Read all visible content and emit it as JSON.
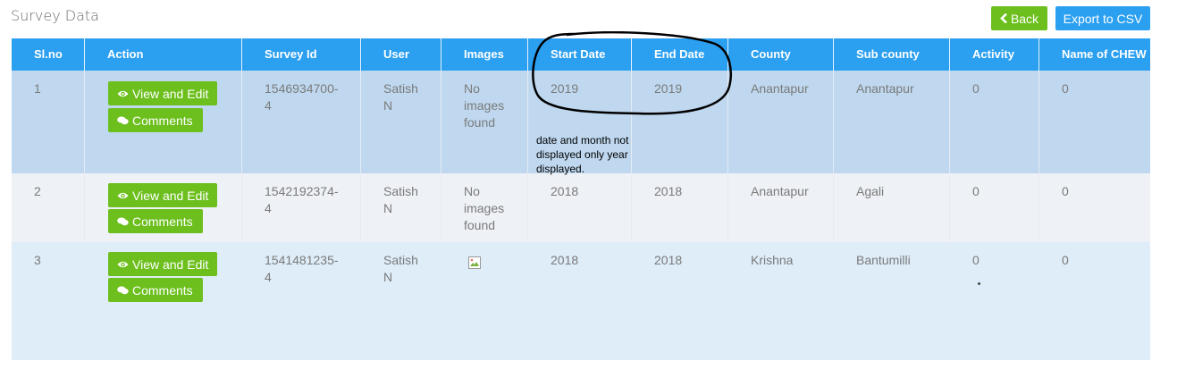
{
  "page": {
    "title": "Survey Data"
  },
  "toolbar": {
    "back_label": "Back",
    "export_label": "Export to CSV"
  },
  "table": {
    "columns": [
      "Sl.no",
      "Action",
      "Survey Id",
      "User",
      "Images",
      "Start Date",
      "End Date",
      "County",
      "Sub county",
      "Activity",
      "Name of CHEW"
    ],
    "action_labels": {
      "view_edit": "View and Edit",
      "comments": "Comments"
    },
    "rows": [
      {
        "slno": "1",
        "survey_id": "1546934700-4",
        "user": "Satish N",
        "images": "No images found",
        "start_date": "2019",
        "end_date": "2019",
        "county": "Anantapur",
        "sub_county": "Anantapur",
        "activity": "0",
        "chew": "0"
      },
      {
        "slno": "2",
        "survey_id": "1542192374-4",
        "user": "Satish N",
        "images": "No images found",
        "start_date": "2018",
        "end_date": "2018",
        "county": "Anantapur",
        "sub_county": "Agali",
        "activity": "0",
        "chew": "0"
      },
      {
        "slno": "3",
        "survey_id": "1541481235-4",
        "user": "Satish N",
        "images": "",
        "start_date": "2018",
        "end_date": "2018",
        "county": "Krishna",
        "sub_county": "Bantumilli",
        "activity": "0",
        "chew": "0"
      }
    ]
  },
  "annotation": {
    "note": "date and month not displayed only year displayed."
  },
  "icons": {
    "back": "chevron-left-icon",
    "view": "eye-icon",
    "comments": "comments-icon",
    "broken_image": "broken-image-icon"
  },
  "colors": {
    "header_blue": "#2b9ff0",
    "action_green": "#6cbf1d",
    "row_highlight": "#bfd8ef"
  }
}
